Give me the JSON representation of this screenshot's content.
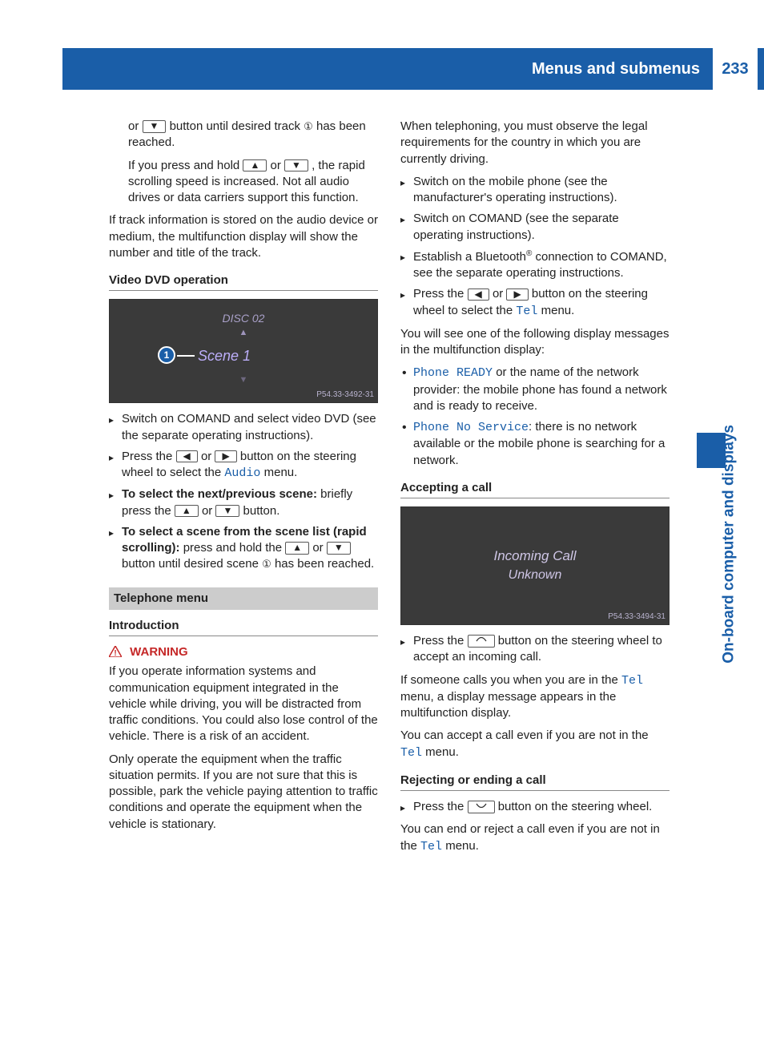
{
  "header": {
    "title": "Menus and submenus",
    "page": "233"
  },
  "side_tab": "On-board computer and displays",
  "left": {
    "p1_a": "or ",
    "p1_b": " button until desired track ",
    "p1_c": " has been reached.",
    "p2_a": "If you press and hold ",
    "p2_or": " or ",
    "p2_b": ", the rapid scrolling speed is increased. Not all audio drives or data carriers support this function.",
    "p3": "If track information is stored on the audio device or medium, the multifunction display will show the number and title of the track.",
    "h_dvd": "Video DVD operation",
    "dvd": {
      "disc": "DISC 02",
      "scene": "Scene 1",
      "code": "P54.33-3492-31"
    },
    "dvd_b1": "Switch on COMAND and select video DVD (see the separate operating instructions).",
    "dvd_b2_a": "Press the ",
    "dvd_b2_or": " or ",
    "dvd_b2_b": " button on the steering wheel to select the ",
    "dvd_b2_menu": "Audio",
    "dvd_b2_c": " menu.",
    "dvd_b3_bold": "To select the next/previous scene:",
    "dvd_b3_a": " briefly press the ",
    "dvd_b3_or": " or ",
    "dvd_b3_b": " button.",
    "dvd_b4_bold": "To select a scene from the scene list (rapid scrolling):",
    "dvd_b4_a": " press and hold the ",
    "dvd_b4_or": " or ",
    "dvd_b4_b": " button until desired scene ",
    "dvd_b4_c": " has been reached.",
    "sec_tel": "Telephone menu",
    "h_intro": "Introduction",
    "warn_head": "WARNING",
    "warn_p1": "If you operate information systems and communication equipment integrated in the vehicle while driving, you will be distracted from traffic conditions. You could also lose control of the vehicle. There is a risk of an accident.",
    "warn_p2": "Only operate the equipment when the traffic situation permits. If you are not sure that this is possible, park the vehicle paying attention to traffic conditions and operate the equipment when the vehicle is stationary."
  },
  "right": {
    "p1": "When telephoning, you must observe the legal requirements for the country in which you are currently driving.",
    "b1": "Switch on the mobile phone (see the manufacturer's operating instructions).",
    "b2": "Switch on COMAND (see the separate operating instructions).",
    "b3_a": "Establish a Bluetooth",
    "b3_b": " connection to COMAND, see the separate operating instructions.",
    "b4_a": "Press the ",
    "b4_or": " or ",
    "b4_b": " button on the steering wheel to select the ",
    "b4_menu": "Tel",
    "b4_c": " menu.",
    "p2": "You will see one of the following display messages in the multifunction display:",
    "d1_code": "Phone READY",
    "d1_txt": " or the name of the network provider: the mobile phone has found a network and is ready to receive.",
    "d2_code": "Phone No Service",
    "d2_txt": ": there is no network available or the mobile phone is searching for a network.",
    "h_accept": "Accepting a call",
    "call": {
      "l1": "Incoming Call",
      "l2": "Unknown",
      "code": "P54.33-3494-31"
    },
    "acc_b1_a": "Press the ",
    "acc_b1_b": " button on the steering wheel to accept an incoming call.",
    "acc_p1_a": "If someone calls you when you are in the ",
    "acc_p1_menu": "Tel",
    "acc_p1_b": " menu, a display message appears in the multifunction display.",
    "acc_p2_a": "You can accept a call even if you are not in the ",
    "acc_p2_menu": "Tel",
    "acc_p2_b": " menu.",
    "h_reject": "Rejecting or ending a call",
    "rej_b1_a": "Press the ",
    "rej_b1_b": " button on the steering wheel.",
    "rej_p1_a": "You can end or reject a call even if you are not in the ",
    "rej_p1_menu": "Tel",
    "rej_p1_b": " menu."
  },
  "icons": {
    "up": "▲",
    "down": "▼",
    "left": "◀",
    "right": "▶",
    "accept": "✆",
    "reject": "⌕",
    "circ1": "①"
  }
}
